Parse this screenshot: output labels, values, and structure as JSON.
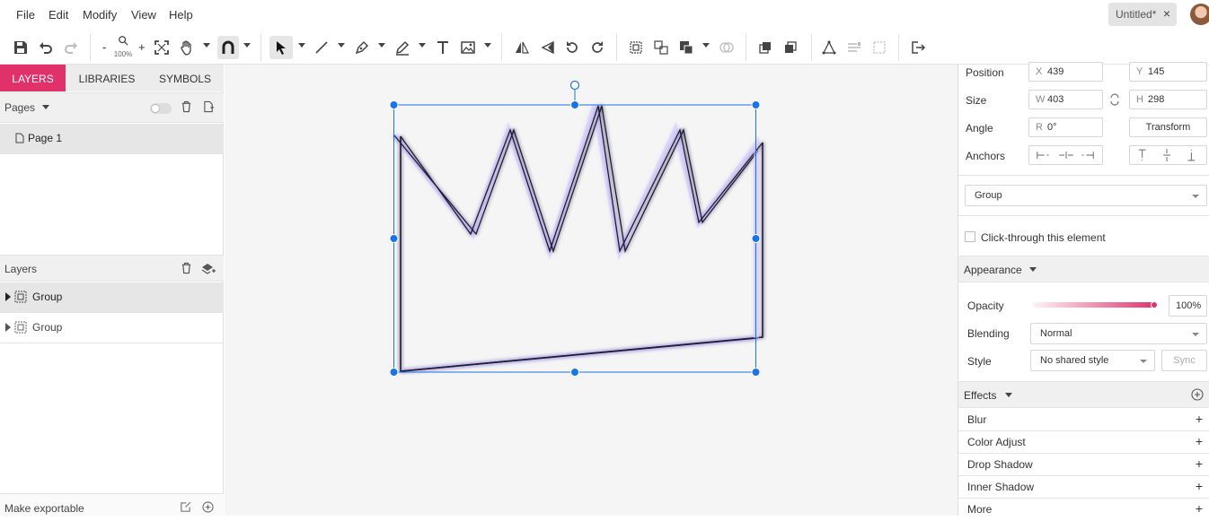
{
  "menubar": {
    "items": [
      "File",
      "Edit",
      "Modify",
      "View",
      "Help"
    ],
    "document_tab": "Untitled*"
  },
  "toolbar": {
    "zoom_minus": "-",
    "zoom_plus": "+",
    "zoom_level": "100%"
  },
  "left_panel": {
    "tabs": [
      "LAYERS",
      "LIBRARIES",
      "SYMBOLS"
    ],
    "pages_label": "Pages",
    "pages": [
      "Page 1"
    ],
    "layers_label": "Layers",
    "layers": [
      "Group",
      "Group"
    ],
    "make_exportable": "Make exportable"
  },
  "right_panel": {
    "position_label": "Position",
    "x_prefix": "X",
    "x_value": "439",
    "y_prefix": "Y",
    "y_value": "145",
    "size_label": "Size",
    "w_prefix": "W",
    "w_value": "403",
    "h_prefix": "H",
    "h_value": "298",
    "angle_label": "Angle",
    "r_prefix": "R",
    "r_value": "0°",
    "transform_button": "Transform",
    "anchors_label": "Anchors",
    "element_type": "Group",
    "click_through": "Click-through this element",
    "appearance_label": "Appearance",
    "opacity_label": "Opacity",
    "opacity_value": "100%",
    "opacity_level": 1.0,
    "blending_label": "Blending",
    "blending_value": "Normal",
    "style_label": "Style",
    "style_value": "No shared style",
    "sync_button": "Sync",
    "effects_label": "Effects",
    "effects": [
      "Blur",
      "Color Adjust",
      "Drop Shadow",
      "Inner Shadow",
      "More"
    ]
  },
  "colors": {
    "accent": "#e0316b",
    "selection": "#1a73e8",
    "stroke": "#1c1a3a"
  }
}
